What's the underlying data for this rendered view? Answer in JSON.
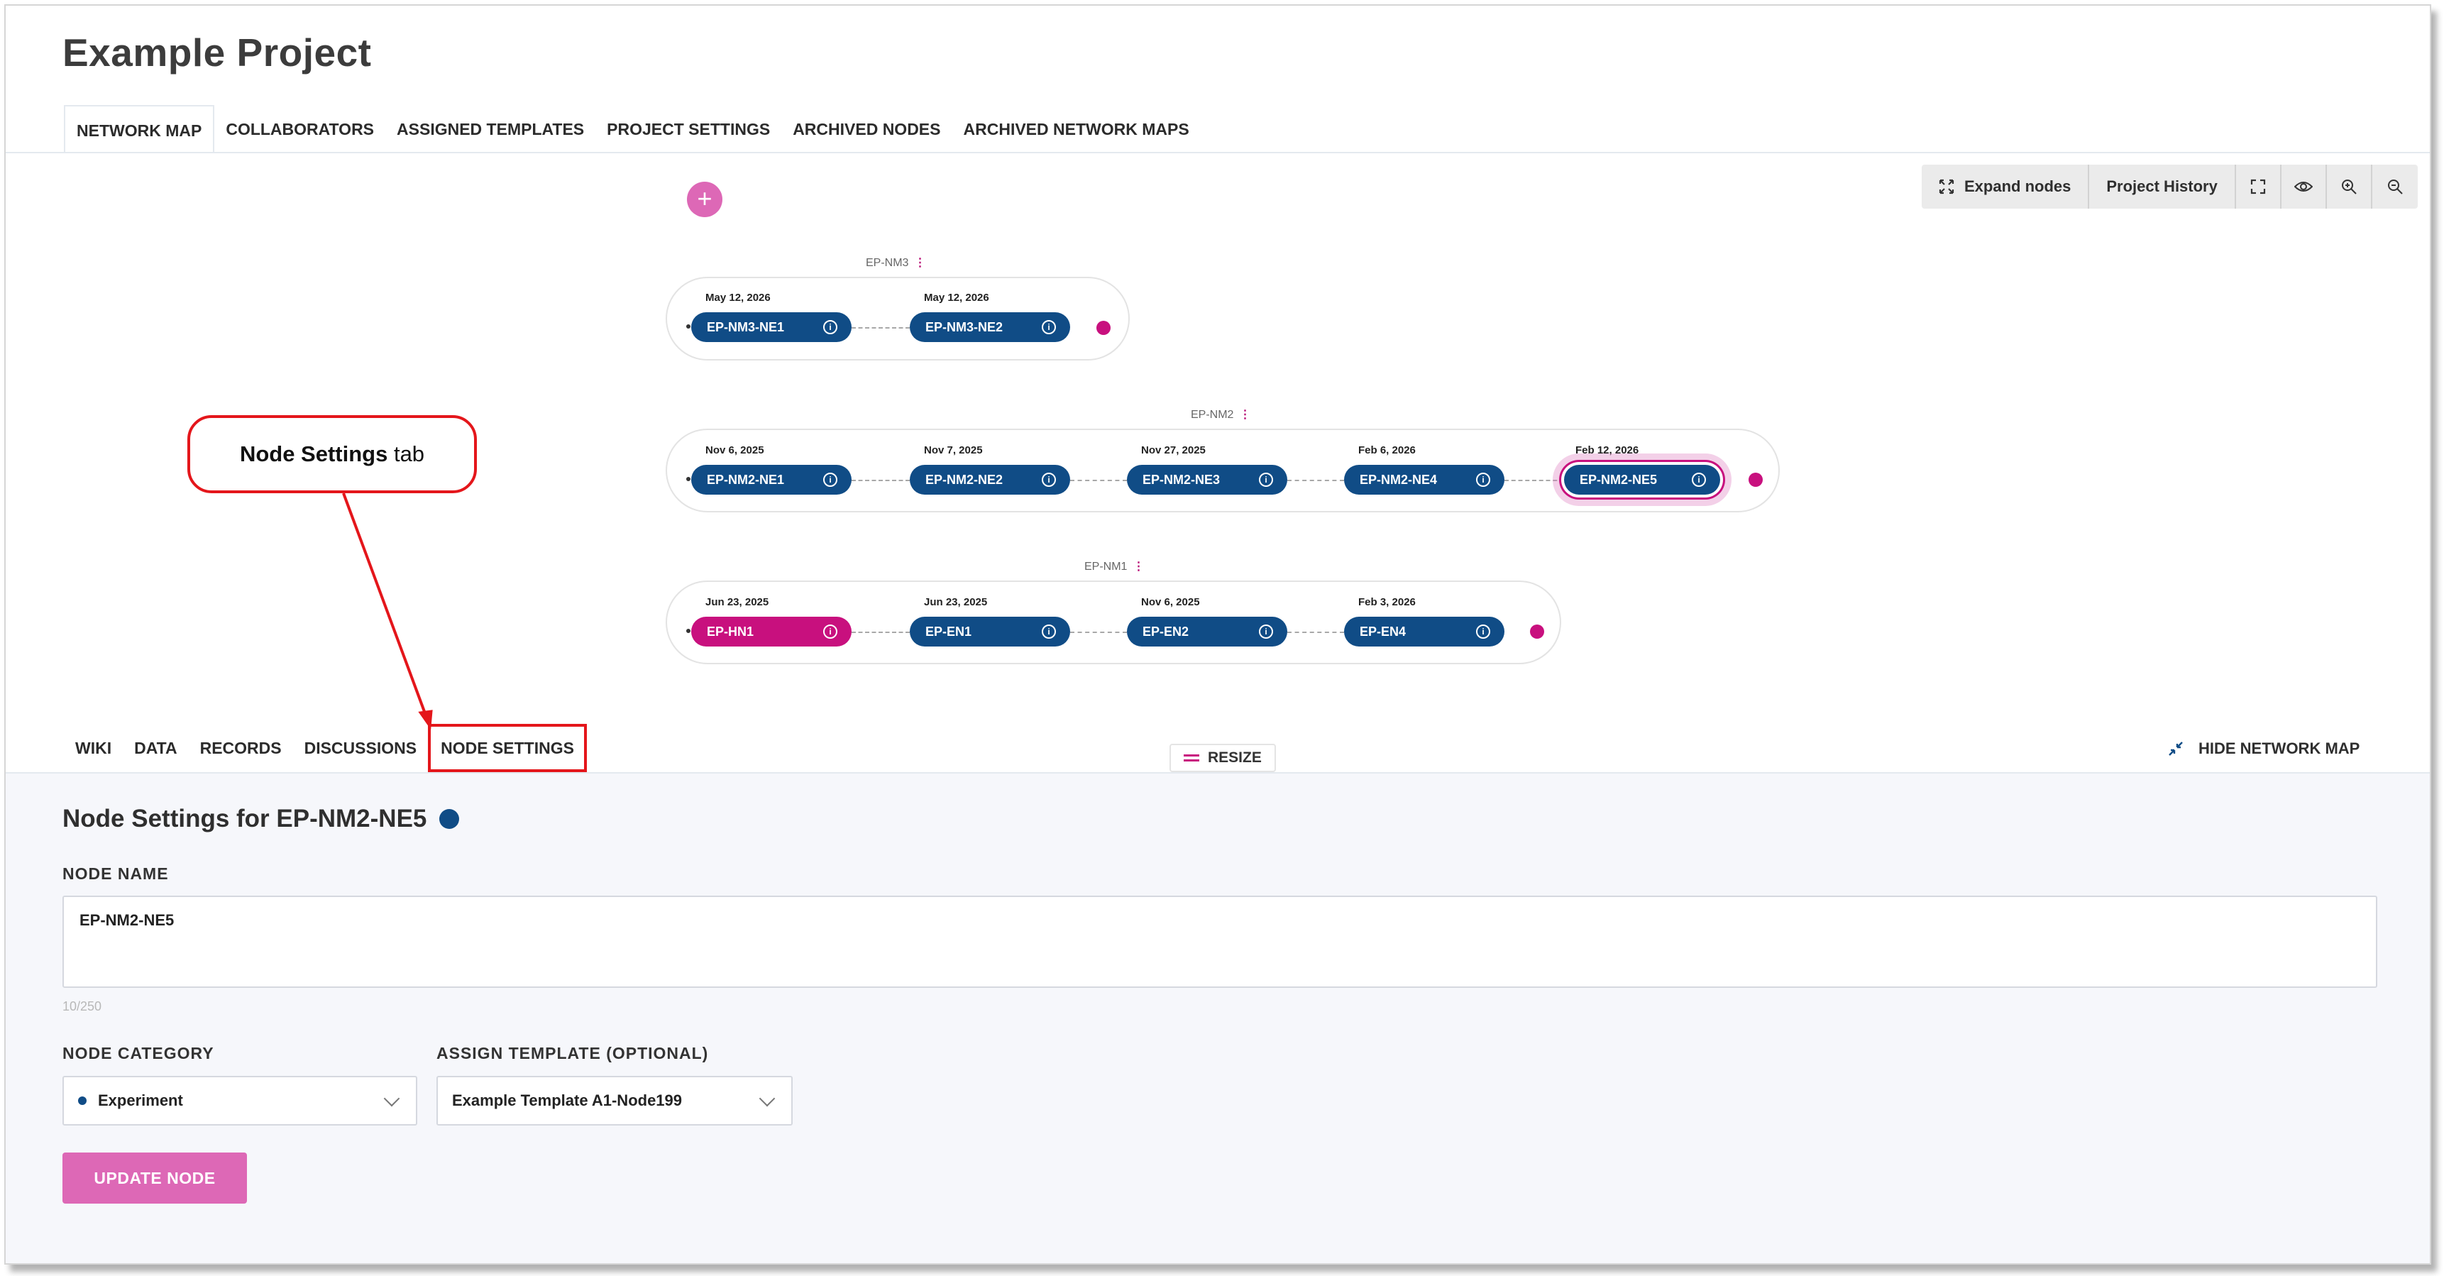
{
  "project": {
    "title": "Example Project"
  },
  "top_tabs": [
    {
      "label": "NETWORK MAP",
      "active": true
    },
    {
      "label": "COLLABORATORS",
      "active": false
    },
    {
      "label": "ASSIGNED TEMPLATES",
      "active": false
    },
    {
      "label": "PROJECT SETTINGS",
      "active": false
    },
    {
      "label": "ARCHIVED NODES",
      "active": false
    },
    {
      "label": "ARCHIVED NETWORK MAPS",
      "active": false
    }
  ],
  "toolbar": {
    "expand_label": "Expand nodes",
    "history_label": "Project History",
    "icons": [
      "fullscreen-icon",
      "eye-icon",
      "zoom-in-icon",
      "zoom-out-icon"
    ]
  },
  "add_button": {
    "label": "+"
  },
  "network_maps": [
    {
      "label": "EP-NM3",
      "nodes": [
        {
          "name": "EP-NM3-NE1",
          "date": "May 12, 2026",
          "category": "experiment",
          "selected": false
        },
        {
          "name": "EP-NM3-NE2",
          "date": "May 12, 2026",
          "category": "experiment",
          "selected": false
        }
      ]
    },
    {
      "label": "EP-NM2",
      "nodes": [
        {
          "name": "EP-NM2-NE1",
          "date": "Nov 6, 2025",
          "category": "experiment",
          "selected": false
        },
        {
          "name": "EP-NM2-NE2",
          "date": "Nov 7, 2025",
          "category": "experiment",
          "selected": false
        },
        {
          "name": "EP-NM2-NE3",
          "date": "Nov 27, 2025",
          "category": "experiment",
          "selected": false
        },
        {
          "name": "EP-NM2-NE4",
          "date": "Feb 6, 2026",
          "category": "experiment",
          "selected": false
        },
        {
          "name": "EP-NM2-NE5",
          "date": "Feb 12, 2026",
          "category": "experiment",
          "selected": true
        }
      ]
    },
    {
      "label": "EP-NM1",
      "nodes": [
        {
          "name": "EP-HN1",
          "date": "Jun 23, 2025",
          "category": "hub",
          "selected": false
        },
        {
          "name": "EP-EN1",
          "date": "Jun 23, 2025",
          "category": "experiment",
          "selected": false
        },
        {
          "name": "EP-EN2",
          "date": "Nov 6, 2025",
          "category": "experiment",
          "selected": false
        },
        {
          "name": "EP-EN4",
          "date": "Feb 3, 2026",
          "category": "experiment",
          "selected": false
        }
      ]
    }
  ],
  "callout": {
    "bold": "Node Settings",
    "rest": " tab"
  },
  "sub_tabs": [
    {
      "label": "WIKI"
    },
    {
      "label": "DATA"
    },
    {
      "label": "RECORDS"
    },
    {
      "label": "DISCUSSIONS"
    },
    {
      "label": "NODE SETTINGS"
    }
  ],
  "resize": {
    "label": "RESIZE"
  },
  "hide_map": {
    "label": "HIDE NETWORK MAP"
  },
  "panel": {
    "title": "Node Settings for EP-NM2-NE5",
    "node_name_label": "NODE NAME",
    "node_name_value": "EP-NM2-NE5",
    "char_counter": "10/250",
    "category_label": "NODE CATEGORY",
    "category_value": "Experiment",
    "template_label": "ASSIGN TEMPLATE (OPTIONAL)",
    "template_value": "Example Template A1-Node199",
    "update_button": "UPDATE NODE"
  },
  "colors": {
    "experiment": "#104c86",
    "hub": "#c8107e",
    "accent_pink": "#dd68b6",
    "annotation_red": "#e4161b"
  }
}
